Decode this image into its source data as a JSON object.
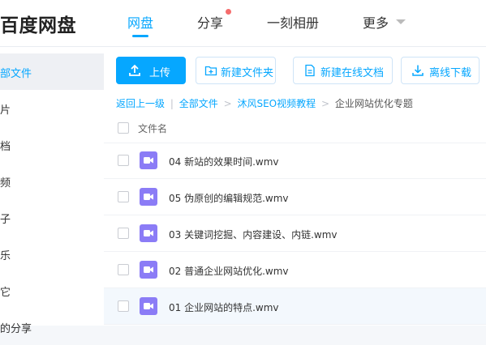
{
  "app": {
    "logo": "百度网盘"
  },
  "nav": {
    "items": [
      {
        "label": "网盘",
        "active": true
      },
      {
        "label": "分享",
        "badge_dot": true
      },
      {
        "label": "一刻相册"
      },
      {
        "label": "更多",
        "has_dropdown": true
      }
    ]
  },
  "sidebar": {
    "items": [
      {
        "label": "部文件",
        "active": true
      },
      {
        "label": "片"
      },
      {
        "label": "档"
      },
      {
        "label": "频"
      },
      {
        "label": "子"
      },
      {
        "label": "乐"
      },
      {
        "label": "它"
      },
      {
        "label": "的分享"
      }
    ]
  },
  "toolbar": {
    "upload_label": "上传",
    "new_folder_label": "新建文件夹",
    "new_online_doc_label": "新建在线文档",
    "offline_download_label": "离线下载"
  },
  "breadcrumb": {
    "back": "返回上一级",
    "separator_bar": "|",
    "items": [
      "全部文件",
      "沐风SEO视频教程",
      "企业网站优化专题"
    ],
    "arrow": ">"
  },
  "file_list": {
    "header_label": "文件名",
    "files": [
      {
        "name": "04 新站的效果时间.wmv",
        "icon": "video-file-icon"
      },
      {
        "name": "05 伪原创的编辑规范.wmv",
        "icon": "video-file-icon"
      },
      {
        "name": "03 关键词挖掘、内容建设、内链.wmv",
        "icon": "video-file-icon"
      },
      {
        "name": "02 普通企业网站优化.wmv",
        "icon": "video-file-icon"
      },
      {
        "name": "01 企业网站的特点.wmv",
        "icon": "video-file-icon",
        "highlighted": true
      }
    ]
  },
  "colors": {
    "accent": "#06a7ff",
    "file_icon": "#8b7cf6",
    "badge": "#f56c6c"
  }
}
